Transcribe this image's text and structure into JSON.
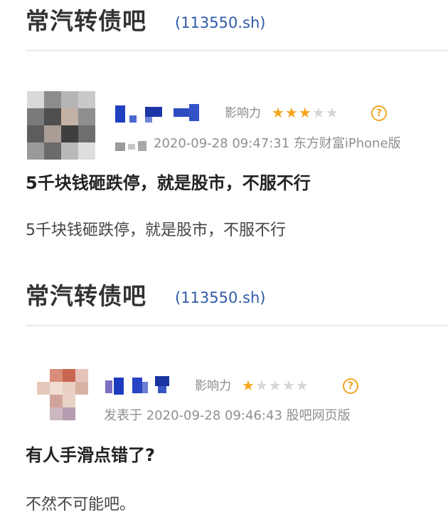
{
  "posts": [
    {
      "bar": {
        "title": "常汽转债吧",
        "code": "(113550.sh)"
      },
      "author": {
        "influence_label": "影响力",
        "rating": 3,
        "rating_max": 5,
        "help_glyph": "?",
        "meta": "2020-09-28 09:47:31 东方财富iPhone版"
      },
      "title": "5千块钱砸跌停，就是股市，不服不行",
      "body": "5千块钱砸跌停，就是股市，不服不行"
    },
    {
      "bar": {
        "title": "常汽转债吧",
        "code": "(113550.sh)"
      },
      "author": {
        "influence_label": "影响力",
        "rating": 1,
        "rating_max": 5,
        "help_glyph": "?",
        "meta": "发表于 2020-09-28 09:46:43 股吧网页版"
      },
      "title": "有人手滑点错了?",
      "body": "不然不可能吧。"
    }
  ],
  "icons": {
    "star": "star-icon",
    "help": "help-circle-icon"
  },
  "colors": {
    "star_on": "#f7a41c",
    "star_off": "#d6d6d6",
    "code_link": "#2f5aa8",
    "meta_text": "#8f8f8f"
  }
}
